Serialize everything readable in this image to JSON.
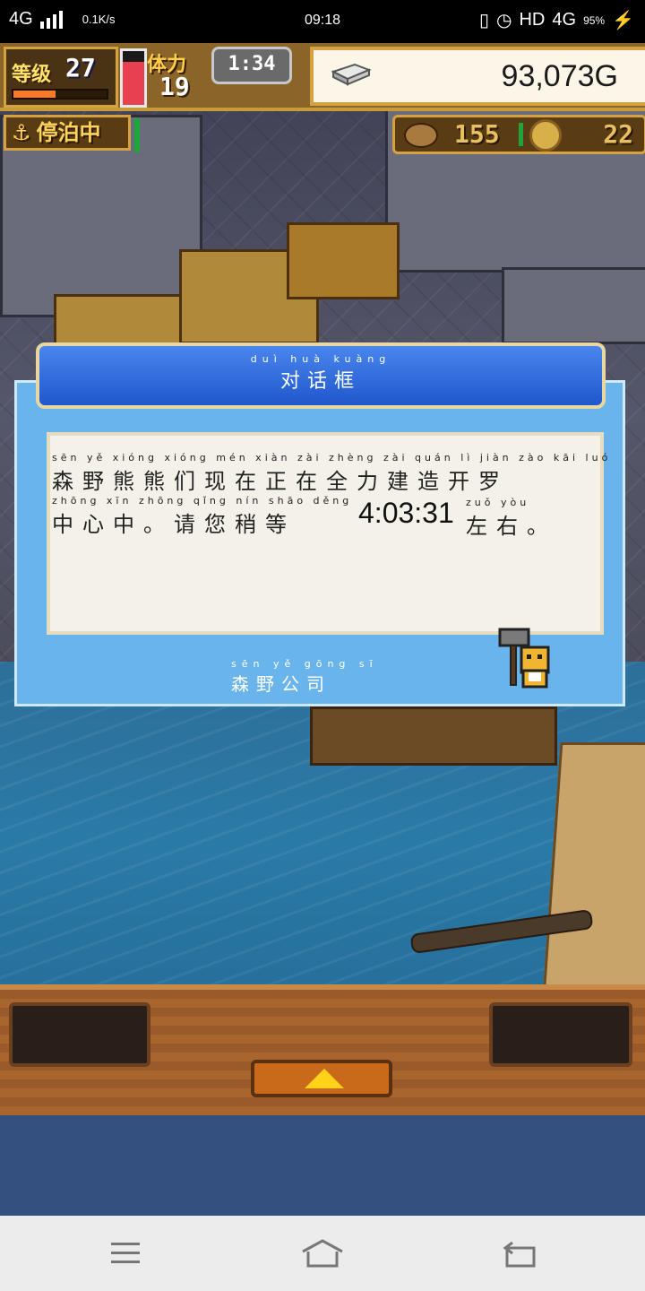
{
  "status_bar": {
    "network": "4G",
    "speed": "0.1K/s",
    "time": "09:18",
    "hd_label": "HD",
    "network_right": "4G",
    "battery": "95%"
  },
  "hud": {
    "level_label": "等级",
    "level_value": "27",
    "xp_fraction": 0.45,
    "stamina_label": "体力",
    "stamina_value": "19",
    "stamina_fraction": 0.8,
    "timer": "1:34",
    "gold": "93,073G",
    "docked_label": "停泊中",
    "resource1": "155",
    "resource2": "22"
  },
  "dialog": {
    "title_pinyin": "duì huà kuàng",
    "title": "对话框",
    "line1_pinyin": "sēn yě xióng xióng mén xiàn zài zhèng zài quán lì jiàn zào kāi luó",
    "line1": "森野熊熊们现在正在全力建造开罗",
    "line2_pinyin": "zhōng xīn zhōng qǐng nín shāo děng",
    "line2": "中心中。请您稍等",
    "countdown": "4:03:31",
    "line2b_pinyin": "zuǒ yòu",
    "line2b": "左右。",
    "sender_pinyin": "sēn yě gōng sī",
    "sender": "森野公司"
  },
  "icons": {
    "gear": "gear-icon",
    "back": "back-icon",
    "home": "home-icon",
    "menu": "menu-icon"
  }
}
